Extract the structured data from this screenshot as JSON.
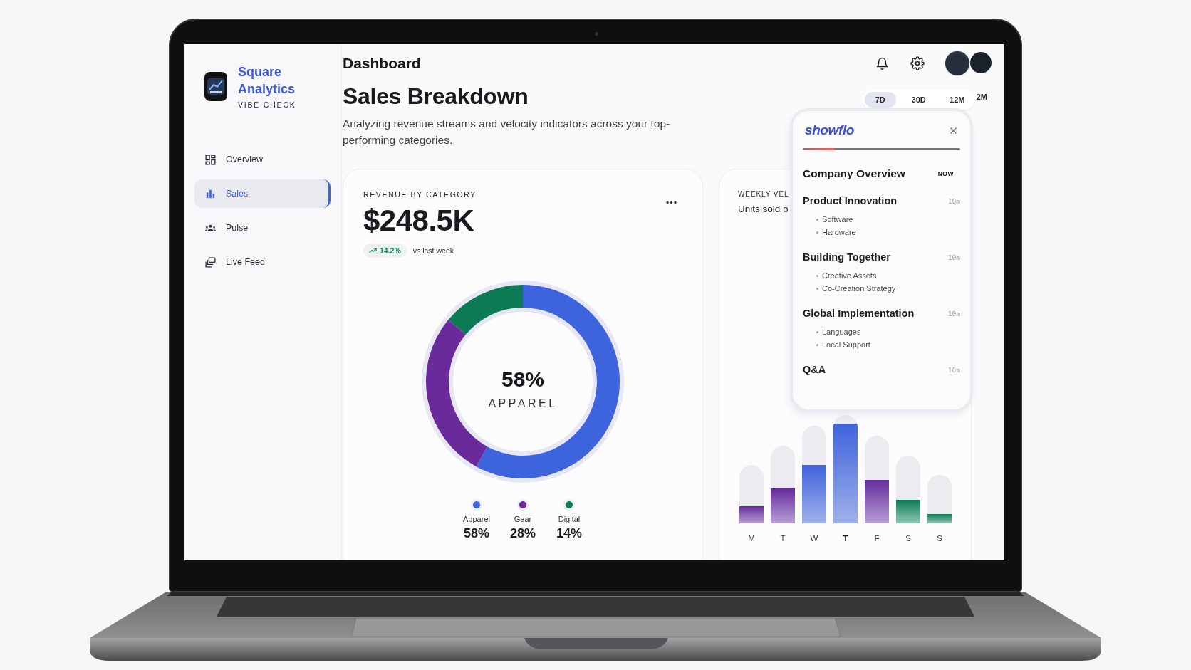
{
  "sidebar": {
    "brand": {
      "name": "Square Analytics",
      "tagline": "VIBE CHECK"
    },
    "items": [
      {
        "label": "Overview",
        "selected": false
      },
      {
        "label": "Sales",
        "selected": true
      },
      {
        "label": "Pulse",
        "selected": false
      },
      {
        "label": "Live Feed",
        "selected": false
      }
    ]
  },
  "header": {
    "title": "Dashboard"
  },
  "page": {
    "title": "Sales Breakdown",
    "description": "Analyzing revenue streams and velocity indicators across your top-performing categories."
  },
  "time_range": {
    "options": [
      {
        "label": "7D",
        "selected": true
      },
      {
        "label": "30D",
        "selected": false
      },
      {
        "label": "12M",
        "selected": false
      }
    ],
    "overflow_label": "2M"
  },
  "revenue_card": {
    "label": "REVENUE BY CATEGORY",
    "amount": "$248.5K",
    "change": "14.2%",
    "change_caption": "vs last week",
    "center_value": "58%",
    "center_label": "APPAREL",
    "legend": [
      {
        "value": "58%",
        "color": "#3d63dd"
      },
      {
        "value": "28%",
        "color": "#6a2a9c"
      },
      {
        "value": "14%",
        "color": "#0b7a55"
      }
    ],
    "chart_data": {
      "type": "donut",
      "categories": [
        "Apparel",
        "Gear",
        "Digital"
      ],
      "values": [
        58,
        28,
        14
      ]
    }
  },
  "velocity_card": {
    "label": "WEEKLY VEL",
    "subtitle": "Units sold p",
    "days": [
      {
        "label": "M",
        "selected": false
      },
      {
        "label": "T",
        "selected": false
      },
      {
        "label": "W",
        "selected": false
      },
      {
        "label": "T",
        "selected": true
      },
      {
        "label": "F",
        "selected": false
      },
      {
        "label": "S",
        "selected": false
      },
      {
        "label": "S",
        "selected": false
      }
    ]
  },
  "agenda_popup": {
    "brand": "showflo",
    "progress": {
      "level": 0.2
    },
    "items": [
      {
        "title": "Company Overview",
        "time": "NOW",
        "current": true
      },
      {
        "title": "Product Innovation",
        "time": "10m",
        "current": false,
        "subitems": [
          "Software",
          "Hardware"
        ]
      },
      {
        "title": "Building Together",
        "time": "10m",
        "current": false,
        "subitems": [
          "Creative Assets",
          "Co-Creation Strategy"
        ]
      },
      {
        "title": "Global Implementation",
        "time": "10m",
        "current": false,
        "subitems": [
          "Languages",
          "Local Support"
        ]
      },
      {
        "title": "Q&A",
        "time": "10m",
        "current": false
      }
    ]
  }
}
